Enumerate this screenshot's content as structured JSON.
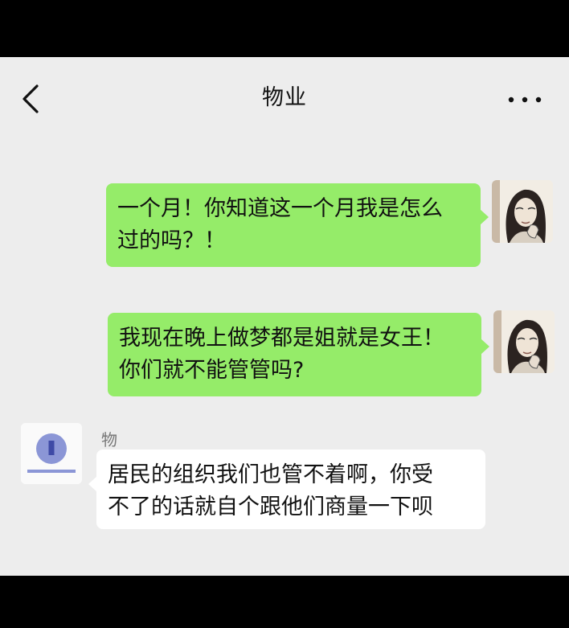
{
  "header": {
    "title": "物业",
    "back_icon": "chevron-left-icon",
    "more_icon": "more-dots-icon"
  },
  "messages": [
    {
      "side": "right",
      "lines": [
        "一个月！你知道这一个月我是怎么",
        "过的吗？！"
      ]
    },
    {
      "side": "right",
      "lines": [
        "我现在晚上做梦都是姐就是女王！",
        "你们就不能管管吗?"
      ]
    },
    {
      "side": "left",
      "sender": "物业",
      "lines": [
        "居民的组织我们也管不着啊，你受",
        "不了的话就自个跟他们商量一下呗"
      ]
    }
  ],
  "colors": {
    "background": "#ededed",
    "outgoing_bubble": "#95ec69",
    "incoming_bubble": "#ffffff",
    "frame": "#000000"
  }
}
